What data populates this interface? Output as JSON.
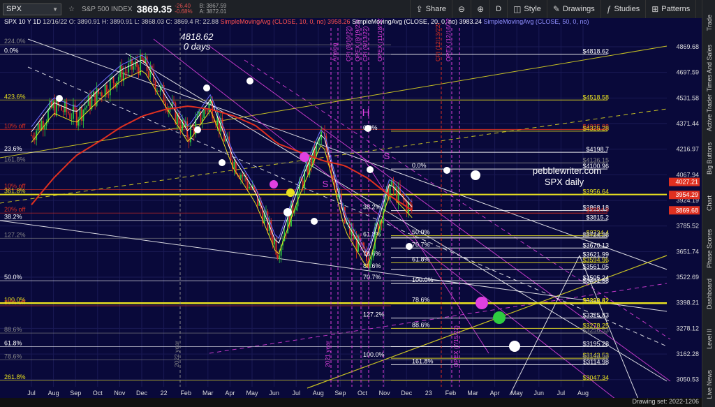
{
  "toolbar": {
    "symbol": "SPX",
    "index_name": "S&P 500 INDEX",
    "price": "3869.35",
    "change": "-26.40",
    "change_pct": "-0.68%",
    "bid": "B: 3867.59",
    "ask": "A: 3872.01",
    "buttons": {
      "share": "Share",
      "period": "D",
      "style": "Style",
      "drawings": "Drawings",
      "studies": "Studies",
      "patterns": "Patterns"
    }
  },
  "ohlc": {
    "symbol": "SPX 10 Y 1D",
    "date": "12/16/22",
    "open": "O: 3890.91",
    "high": "H: 3890.91",
    "low": "L: 3868.03",
    "close": "C: 3869.4",
    "range": "R: 22.88",
    "sma10": "SimpleMovingAvg (CLOSE, 10, 0, no)",
    "sma10_val": "3958.26",
    "sma20": "SimpleMovingAvg (CLOSE, 20, 0, no)",
    "sma20_val": "3983.24",
    "sma50": "SimpleMovingAvg (CLOSE, 50, 0, no)"
  },
  "right_tabs": [
    "Trade",
    "Times And Sales",
    "Active Trader",
    "Big Buttons",
    "Chart",
    "Phase Scores",
    "Dashboard",
    "Level II",
    "Live News"
  ],
  "drawing_set": "Drawing set: 2022-1206",
  "colors": {
    "background": "#09093a",
    "yellow": "#e8e020",
    "magenta": "#e040e0",
    "red": "#e03020",
    "white": "#ffffff",
    "candle_up": "#2ecc40",
    "candle_down": "#e03020",
    "sma10": "#e8e020",
    "sma20": "#ffffff",
    "sma50": "#7070ff"
  },
  "chart_data": {
    "type": "line",
    "title": "SPX daily",
    "watermark": "pebblewriter.com",
    "annotation_peak": "4818.62",
    "annotation_days": "0 days",
    "x_ticks": [
      "Jul",
      "Aug",
      "Sep",
      "Oct",
      "Nov",
      "Dec",
      "22",
      "Feb",
      "Mar",
      "Apr",
      "May",
      "Jun",
      "Jul",
      "Aug",
      "Sep",
      "Oct",
      "Nov",
      "Dec",
      "23",
      "Feb",
      "Mar",
      "Apr",
      "May",
      "Jun",
      "Jul",
      "Aug"
    ],
    "y_ticks": [
      4869.68,
      4697.59,
      4531.58,
      4371.44,
      4216.97,
      4067.94,
      3924.19,
      3785.52,
      3651.74,
      3522.69,
      3398.21,
      3278.12,
      3162.28,
      3050.53
    ],
    "y_scale": "log",
    "ylim": [
      3020,
      5020
    ],
    "price_tags": [
      {
        "value": 4027.21,
        "label": "4027.21",
        "color": "#e03020"
      },
      {
        "value": 3954.29,
        "label": "3954.29",
        "color": "#e03020"
      },
      {
        "value": 3869.68,
        "label": "3869.68",
        "color": "#e03020"
      }
    ],
    "series": [
      {
        "name": "SPX",
        "x": [
          "2021-07",
          "2021-08",
          "2021-09",
          "2021-10",
          "2021-11",
          "2021-12",
          "2022-01",
          "2022-02",
          "2022-03",
          "2022-04",
          "2022-05",
          "2022-06",
          "2022-07",
          "2022-08",
          "2022-09",
          "2022-10",
          "2022-11",
          "2022-12-16"
        ],
        "values": [
          4300,
          4480,
          4420,
          4560,
          4690,
          4760,
          4520,
          4300,
          4500,
          4150,
          3950,
          3660,
          4000,
          4305,
          3800,
          3600,
          4000,
          3869
        ]
      },
      {
        "name": "SMA 200 (red)",
        "values": [
          3900,
          4050,
          4180,
          4260,
          4350,
          4420,
          4460,
          4480,
          4460,
          4420,
          4360,
          4250,
          4200,
          4150,
          4120,
          4050,
          3950,
          3870
        ]
      }
    ],
    "levels": [
      {
        "value": 4818.62,
        "label": "$4818.62",
        "color": "#ffffff"
      },
      {
        "value": 4518.58,
        "label": "$4518.58",
        "color": "#e8e020"
      },
      {
        "value": 4335.98,
        "label": "$4335.98",
        "color": "#e03020"
      },
      {
        "value": 4325.28,
        "label": "$4325.28",
        "color": "#e8e020"
      },
      {
        "value": 4198.7,
        "label": "$4198.7",
        "color": "#ffffff"
      },
      {
        "value": 4136.15,
        "label": "$4136.15",
        "color": "#888888"
      },
      {
        "value": 4100.96,
        "label": "$4100.96",
        "color": "#ffffff"
      },
      {
        "value": 3956.64,
        "label": "$3956.64",
        "color": "#e8e020"
      },
      {
        "value": 3868.18,
        "label": "$3868.18",
        "color": "#ffffff"
      },
      {
        "value": 3854.9,
        "label": "$3854.9",
        "color": "#e03020"
      },
      {
        "value": 3815.2,
        "label": "$3815.2",
        "color": "#ffffff"
      },
      {
        "value": 3734.4,
        "label": "$3734.4",
        "color": "#e8e020"
      },
      {
        "value": 3724.36,
        "label": "$3724.36",
        "color": "#ffffff"
      },
      {
        "value": 3720.37,
        "label": "$3720.37",
        "color": "#888888"
      },
      {
        "value": 3670.13,
        "label": "$3670.13",
        "color": "#ffffff"
      },
      {
        "value": 3621.99,
        "label": "$3621.99",
        "color": "#ffffff"
      },
      {
        "value": 3594.96,
        "label": "$3594.96",
        "color": "#e8e020"
      },
      {
        "value": 3561.05,
        "label": "$3561.05",
        "color": "#ffffff"
      },
      {
        "value": 3505.24,
        "label": "$3505.24",
        "color": "#ffffff"
      },
      {
        "value": 3491.58,
        "label": "$3491.58",
        "color": "#ffffff"
      },
      {
        "value": 3393.52,
        "label": "$3393.52",
        "color": "#e8e020"
      },
      {
        "value": 3396.42,
        "label": "$3396.42",
        "color": "#e8e020"
      },
      {
        "value": 3325.83,
        "label": "$3325.83",
        "color": "#ffffff"
      },
      {
        "value": 3278.25,
        "label": "$3278.25",
        "color": "#e8e020"
      },
      {
        "value": 3256.53,
        "label": "$3256.53",
        "color": "#888888"
      },
      {
        "value": 3195.28,
        "label": "$3195.28",
        "color": "#ffffff"
      },
      {
        "value": 3143.53,
        "label": "$3143.53",
        "color": "#e8e020"
      },
      {
        "value": 3136.36,
        "label": "$3136.36",
        "color": "#888888"
      },
      {
        "value": 3114.98,
        "label": "$3114.98",
        "color": "#ffffff"
      },
      {
        "value": 3047.34,
        "label": "$3047.34",
        "color": "#e8e020"
      }
    ],
    "left_fib_labels": [
      {
        "value": 4883.58,
        "label": "224.0%",
        "color": "#888888"
      },
      {
        "value": 4818.62,
        "label": "0.0%",
        "color": "#ffffff"
      },
      {
        "value": 4518.58,
        "label": "423.6%",
        "color": "#e8e020"
      },
      {
        "value": 4335.98,
        "label": "10% off",
        "color": "#e03020"
      },
      {
        "value": 4198.7,
        "label": "23.6%",
        "color": "#ffffff"
      },
      {
        "value": 4136.15,
        "label": "161.8%",
        "color": "#888888"
      },
      {
        "value": 3984.2,
        "label": "10% off",
        "color": "#e03020"
      },
      {
        "value": 3956.64,
        "label": "361.8%",
        "color": "#e8e020"
      },
      {
        "value": 3854.9,
        "label": "20% off",
        "color": "#e03020"
      },
      {
        "value": 3815.2,
        "label": "38.2%",
        "color": "#ffffff"
      },
      {
        "value": 3720.37,
        "label": "127.2%",
        "color": "#888888"
      },
      {
        "value": 3505.24,
        "label": "50.0%",
        "color": "#ffffff"
      },
      {
        "value": 3396.42,
        "label": "100.0%",
        "color": "#e8e020"
      },
      {
        "value": 3384.0,
        "label": "30% off",
        "color": "#e03020"
      },
      {
        "value": 3256.53,
        "label": "88.6%",
        "color": "#888888"
      },
      {
        "value": 3195.28,
        "label": "61.8%",
        "color": "#ffffff"
      },
      {
        "value": 3136.36,
        "label": "78.6%",
        "color": "#888888"
      },
      {
        "value": 3047.34,
        "label": "261.8%",
        "color": "#e8e020"
      }
    ],
    "mid_fib_labels": [
      {
        "value": 4325.28,
        "label": "0.0%"
      },
      {
        "value": 4100.96,
        "label": "0.0%"
      },
      {
        "value": 3868.18,
        "label": "38.2%"
      },
      {
        "value": 3734.4,
        "label": "50.0%"
      },
      {
        "value": 3724.36,
        "label": "61.8%"
      },
      {
        "value": 3670.13,
        "label": "70.7%"
      },
      {
        "value": 3621.99,
        "label": "78.6%"
      },
      {
        "value": 3594.96,
        "label": "61.8%"
      },
      {
        "value": 3561.05,
        "label": "88.6%"
      },
      {
        "value": 3491.58,
        "label": "100.0%"
      },
      {
        "value": 3505.24,
        "label": "70.7%"
      },
      {
        "value": 3396.42,
        "label": "78.6%"
      },
      {
        "value": 3325.83,
        "label": "127.2%"
      },
      {
        "value": 3278.25,
        "label": "88.6%"
      },
      {
        "value": 3143.53,
        "label": "100.0%"
      },
      {
        "value": 3114.98,
        "label": "161.8%"
      }
    ],
    "event_labels": [
      "Analog",
      "CPI (8/10/22)",
      "OPEX (8/19/22)",
      "CPI (9/13/22)",
      "OPEX (11/18/22)",
      "CPI (12/13/22)",
      "OPEX (12/16/22)",
      "OPEX (7/15/22)",
      "2021 year",
      "2022 year"
    ],
    "pattern_labels": [
      "H",
      "S",
      "S"
    ]
  }
}
